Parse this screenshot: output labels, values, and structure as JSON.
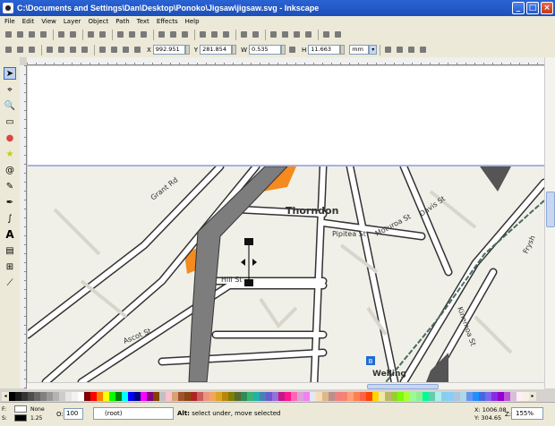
{
  "window": {
    "title": "C:\\Documents and Settings\\Dan\\Desktop\\Ponoko\\Jigsaw\\jigsaw.svg - Inkscape",
    "min_glyph": "_",
    "max_glyph": "□",
    "close_glyph": "×"
  },
  "menu": [
    "File",
    "Edit",
    "View",
    "Layer",
    "Object",
    "Path",
    "Text",
    "Effects",
    "Help"
  ],
  "tool_controls": {
    "x_label": "X",
    "x_value": "992.951",
    "y_label": "Y",
    "y_value": "281.854",
    "w_label": "W",
    "w_value": "0.535",
    "h_label": "H",
    "h_value": "11.663",
    "unit": "mm"
  },
  "map_labels": {
    "grant_rd": "Grant Rd",
    "thorndon": "Thorndon",
    "pipitea": "Pipitea St",
    "moturoa": "Moturoa St",
    "davis": "Davis St",
    "hill_st": "Hill St",
    "ascot": "Ascot St",
    "wellington": "Welling",
    "kinemoa": "Kinemoa St",
    "frysh": "Frysh",
    "station_glyph": "B"
  },
  "palette_colors": [
    "#000000",
    "#1a1a1a",
    "#333333",
    "#4d4d4d",
    "#666666",
    "#808080",
    "#999999",
    "#b3b3b3",
    "#cccccc",
    "#e6e6e6",
    "#f2f2f2",
    "#ffffff",
    "#800000",
    "#ff0000",
    "#ff8000",
    "#ffff00",
    "#00ff00",
    "#008000",
    "#00ffff",
    "#0000ff",
    "#000080",
    "#ff00ff",
    "#800080",
    "#804000",
    "#c0c0c0",
    "#ffc0cb",
    "#d4a373",
    "#a0522d",
    "#8b4513",
    "#b22222",
    "#cd5c5c",
    "#e9967a",
    "#f4a460",
    "#daa520",
    "#b8860b",
    "#808000",
    "#556b2f",
    "#2e8b57",
    "#3cb371",
    "#20b2aa",
    "#4682b4",
    "#6a5acd",
    "#9370db",
    "#c71585",
    "#ff1493",
    "#ff69b4",
    "#dda0dd",
    "#ee82ee",
    "#e6e6fa",
    "#f5deb3",
    "#deb887",
    "#bc8f8f",
    "#f08080",
    "#fa8072",
    "#ffa07a",
    "#ff7f50",
    "#ff6347",
    "#ff4500",
    "#ffd700",
    "#eee8aa",
    "#bdb76b",
    "#9acd32",
    "#7cfc00",
    "#adff2f",
    "#98fb98",
    "#90ee90",
    "#00fa9a",
    "#66cdaa",
    "#afeeee",
    "#87ceeb",
    "#87cefa",
    "#b0c4de",
    "#add8e6",
    "#6495ed",
    "#1e90ff",
    "#4169e1",
    "#7b68ee",
    "#8a2be2",
    "#9400d3",
    "#ba55d3",
    "#d8bfd8",
    "#fff0f5",
    "#faf0e6"
  ],
  "status": {
    "fill_label": "None",
    "stroke_label": "1.25",
    "opacity_label": "O:",
    "opacity_value": "100",
    "layer": "(root)",
    "message_bold": "Alt:",
    "message": " select under, move selected",
    "x_coord": "X: 1006.08",
    "y_coord": "Y: 304.65",
    "zoom_label": "Z:",
    "zoom_value": "155%"
  }
}
